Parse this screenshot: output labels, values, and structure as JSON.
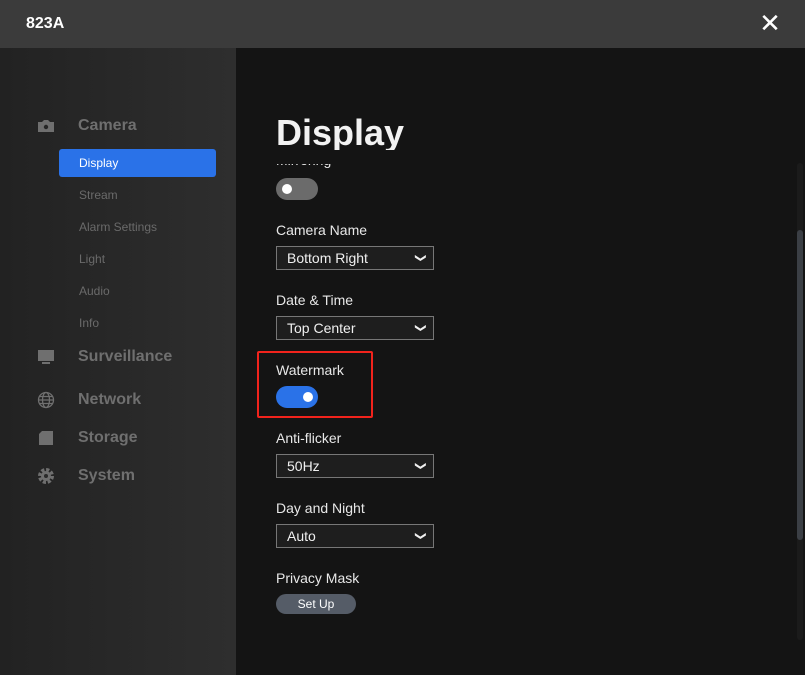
{
  "window": {
    "title": "823A",
    "close_icon": "close-icon"
  },
  "sidebar": {
    "sections": [
      {
        "label": "Camera",
        "icon": "camera-icon"
      },
      {
        "label": "Surveillance",
        "icon": "monitor-icon"
      },
      {
        "label": "Network",
        "icon": "globe-icon"
      },
      {
        "label": "Storage",
        "icon": "sd-card-icon"
      },
      {
        "label": "System",
        "icon": "gear-icon"
      }
    ],
    "camera_items": [
      {
        "label": "Display",
        "active": true
      },
      {
        "label": "Stream"
      },
      {
        "label": "Alarm Settings"
      },
      {
        "label": "Light"
      },
      {
        "label": "Audio"
      },
      {
        "label": "Info"
      }
    ]
  },
  "main": {
    "title": "Display",
    "mirroring": {
      "label": "Mirroring",
      "on": false
    },
    "camera_name": {
      "label": "Camera Name",
      "value": "Bottom Right"
    },
    "date_time": {
      "label": "Date & Time",
      "value": "Top Center"
    },
    "watermark": {
      "label": "Watermark",
      "on": true
    },
    "anti_flicker": {
      "label": "Anti-flicker",
      "value": "50Hz"
    },
    "day_night": {
      "label": "Day and Night",
      "value": "Auto"
    },
    "privacy_mask": {
      "label": "Privacy Mask",
      "button": "Set Up"
    }
  },
  "colors": {
    "accent": "#2a72e8",
    "highlight": "#f2231c",
    "toggle_off": "#6b6b6b"
  }
}
